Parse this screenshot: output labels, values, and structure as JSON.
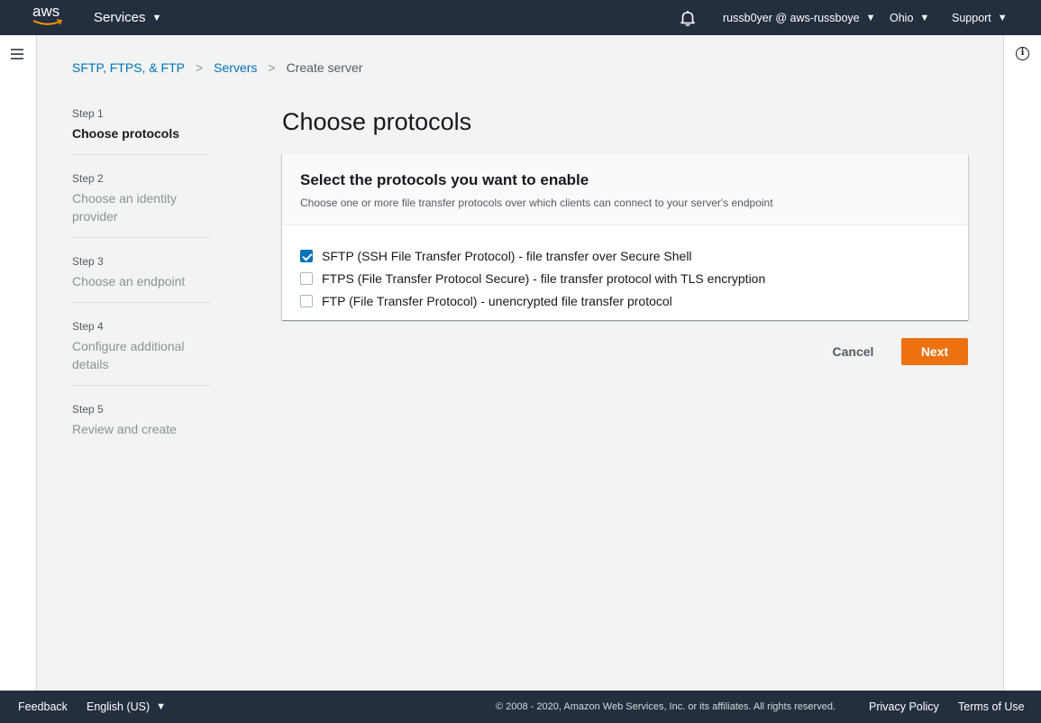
{
  "topnav": {
    "logo_text": "aws",
    "services_label": "Services",
    "bell_icon": "bell-icon",
    "account_label": "russb0yer @ aws-russboye",
    "region_label": "Ohio",
    "support_label": "Support"
  },
  "breadcrumb": {
    "items": [
      "SFTP, FTPS, & FTP",
      "Servers"
    ],
    "current": "Create server"
  },
  "steps": [
    {
      "num": "Step 1",
      "label": "Choose protocols",
      "active": true
    },
    {
      "num": "Step 2",
      "label": "Choose an identity provider",
      "active": false
    },
    {
      "num": "Step 3",
      "label": "Choose an endpoint",
      "active": false
    },
    {
      "num": "Step 4",
      "label": "Configure additional details",
      "active": false
    },
    {
      "num": "Step 5",
      "label": "Review and create",
      "active": false
    }
  ],
  "main": {
    "title": "Choose protocols",
    "panel_title": "Select the protocols you want to enable",
    "panel_description": "Choose one or more file transfer protocols over which clients can connect to your server's endpoint",
    "protocols": [
      {
        "label": "SFTP (SSH File Transfer Protocol) - file transfer over Secure Shell",
        "checked": true
      },
      {
        "label": "FTPS (File Transfer Protocol Secure) - file transfer protocol with TLS encryption",
        "checked": false
      },
      {
        "label": "FTP (File Transfer Protocol) - unencrypted file transfer protocol",
        "checked": false
      }
    ],
    "cancel_label": "Cancel",
    "next_label": "Next"
  },
  "footer": {
    "feedback_label": "Feedback",
    "language_label": "English (US)",
    "copyright": "© 2008 - 2020, Amazon Web Services, Inc. or its affiliates. All rights reserved.",
    "privacy_label": "Privacy Policy",
    "terms_label": "Terms of Use"
  },
  "colors": {
    "nav_bg": "#232f3e",
    "primary_button": "#ec7211",
    "link": "#0073bb",
    "checkbox_checked": "#0073bb"
  }
}
